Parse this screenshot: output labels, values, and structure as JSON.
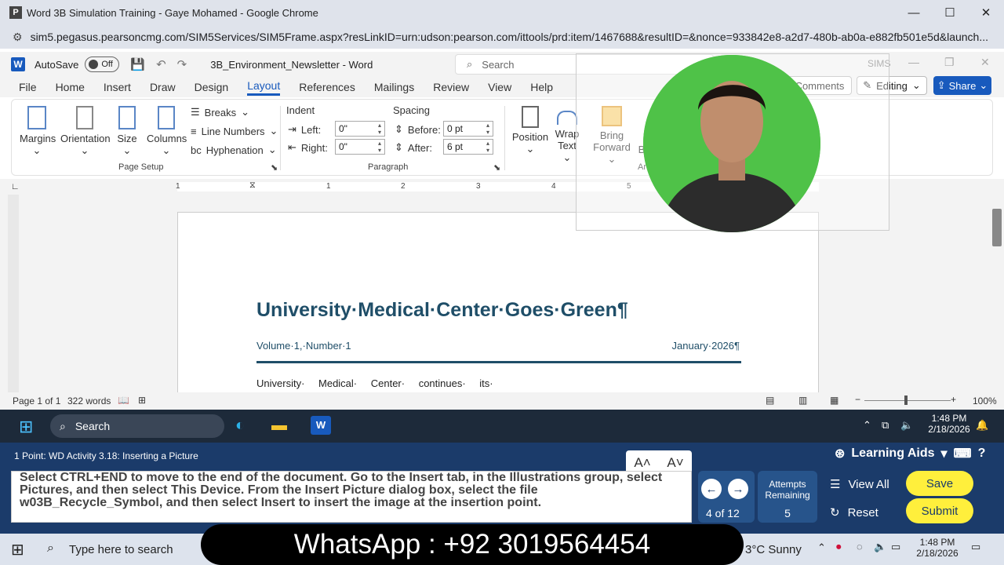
{
  "browser": {
    "title": "Word 3B Simulation Training - Gaye Mohamed - Google Chrome",
    "url": "sim5.pegasus.pearsoncmg.com/SIM5Services/SIM5Frame.aspx?resLinkID=urn:udson:pearson.com/ittools/prd:item/1467688&resultID=&nonce=933842e8-a2d7-480b-ab0a-e882fb501e5d&launch..."
  },
  "word": {
    "autosave_label": "AutoSave",
    "autosave_state": "Off",
    "doc_name": "3B_Environment_Newsletter - Word",
    "search_placeholder": "Search",
    "sims_label": "SIMS",
    "tabs": [
      "File",
      "Home",
      "Insert",
      "Draw",
      "Design",
      "Layout",
      "References",
      "Mailings",
      "Review",
      "View",
      "Help"
    ],
    "active_tab": "Layout",
    "comments_label": "Comments",
    "editing_label": "Editing",
    "share_label": "Share"
  },
  "ribbon": {
    "page_setup": {
      "margins": "Margins",
      "orientation": "Orientation",
      "size": "Size",
      "columns": "Columns",
      "breaks": "Breaks",
      "line_numbers": "Line Numbers",
      "hyphenation": "Hyphenation",
      "group": "Page Setup"
    },
    "paragraph": {
      "indent": "Indent",
      "left": "Left:",
      "left_val": "0\"",
      "right": "Right:",
      "right_val": "0\"",
      "spacing": "Spacing",
      "before": "Before:",
      "before_val": "0 pt",
      "after": "After:",
      "after_val": "6 pt",
      "group": "Paragraph"
    },
    "arrange": {
      "position": "Position",
      "wrap_text": "Wrap Text",
      "bring_forward": "Bring Forward",
      "send_partial": "B",
      "group": "Ar"
    }
  },
  "ruler_numbers": [
    "1",
    "1",
    "2",
    "3",
    "4",
    "5"
  ],
  "document": {
    "title": "University·Medical·Center·Goes·Green¶",
    "volume": "Volume·1,·Number·1",
    "date": "January·2026¶",
    "body": "University· Medical· Center· continues· its·"
  },
  "status": {
    "page": "Page 1 of 1",
    "words": "322 words",
    "zoom": "100%"
  },
  "taskbar": {
    "search": "Search",
    "time": "1:48 PM",
    "date": "2/18/2026"
  },
  "sim": {
    "task_title": "1 Point: WD Activity 3.18: Inserting a Picture",
    "instruction": "Select CTRL+END to move to the end of the document. Go to the Insert tab, in the Illustrations group, select Pictures, and then select This Device. From the Insert Picture dialog box, select the file w03B_Recycle_Symbol, and then select Insert to insert the image at the insertion point.",
    "font_up": "A˄",
    "font_down": "A˅",
    "progress": "4 of 12",
    "attempts_label": "Attempts Remaining",
    "attempts_value": "5",
    "learning_aids": "Learning Aids",
    "view_all": "View All",
    "reset": "Reset",
    "save": "Save",
    "submit": "Submit"
  },
  "os_taskbar": {
    "search_placeholder": "Type here to search",
    "weather": "3°C  Sunny",
    "time": "1:48 PM",
    "date": "2/18/2026"
  },
  "overlay": {
    "whatsapp": "WhatsApp : +92 3019564454"
  }
}
